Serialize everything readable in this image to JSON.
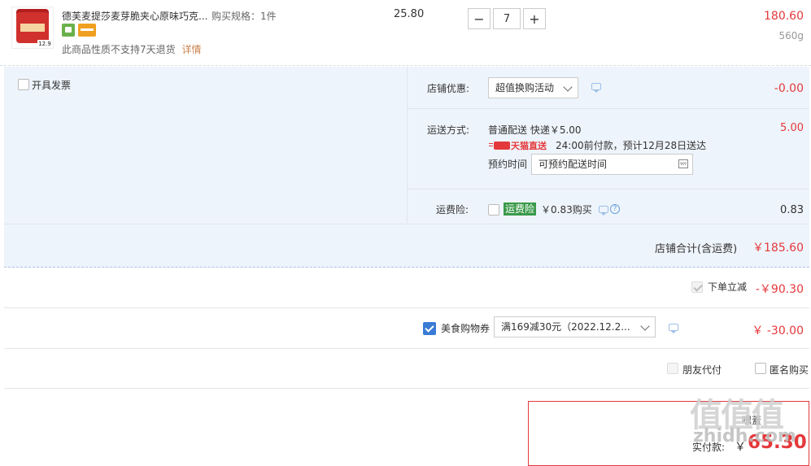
{
  "product": {
    "title": "德芙麦提莎麦芽脆夹心原味巧克...",
    "spec": "购买规格：1件",
    "notice": "此商品性质不支持7天退货",
    "detail_link": "详情",
    "thumb_price": "12.9",
    "unit_price": "25.80",
    "quantity": "7",
    "minus": "−",
    "plus": "+",
    "subtotal": "180.60",
    "weight": "560g"
  },
  "invoice": {
    "label": "开具发票"
  },
  "shop_discount": {
    "label": "店铺优惠:",
    "selected": "超值换购活动",
    "amount": "-0.00"
  },
  "shipping": {
    "label": "运送方式:",
    "method": "普通配送 快递￥5.00",
    "tmall_label": "天猫直送",
    "eta": "24:00前付款，预计12月28日送达",
    "reserve_label": "预约时间",
    "reserve_placeholder": "可预约配送时间",
    "fee": "5.00"
  },
  "insurance": {
    "label": "运费险:",
    "tag": "运费险",
    "price": "￥0.83购买",
    "help": "?",
    "amount": "0.83"
  },
  "shop_total": {
    "label": "店铺合计(含运费)",
    "amount": "￥185.60"
  },
  "order_discount": {
    "label": "下单立减",
    "amount": "-￥90.30"
  },
  "coupon": {
    "label": "美食购物券",
    "selected": "满169减30元（2022.12.2...",
    "amount": "￥ -30.00"
  },
  "options": {
    "friend_pay": "朋友代付",
    "anonymous": "匿名购买"
  },
  "final": {
    "label": "实付款:",
    "currency": "￥",
    "amount": "65.30",
    "top_text": "嘿蓋"
  },
  "watermark": {
    "logo": "值值值",
    "text": "zhidh.com"
  },
  "colors": {
    "accent_red": "#e4393c",
    "section_bg": "#eef4fb",
    "checkbox_blue": "#3a7bd5"
  }
}
